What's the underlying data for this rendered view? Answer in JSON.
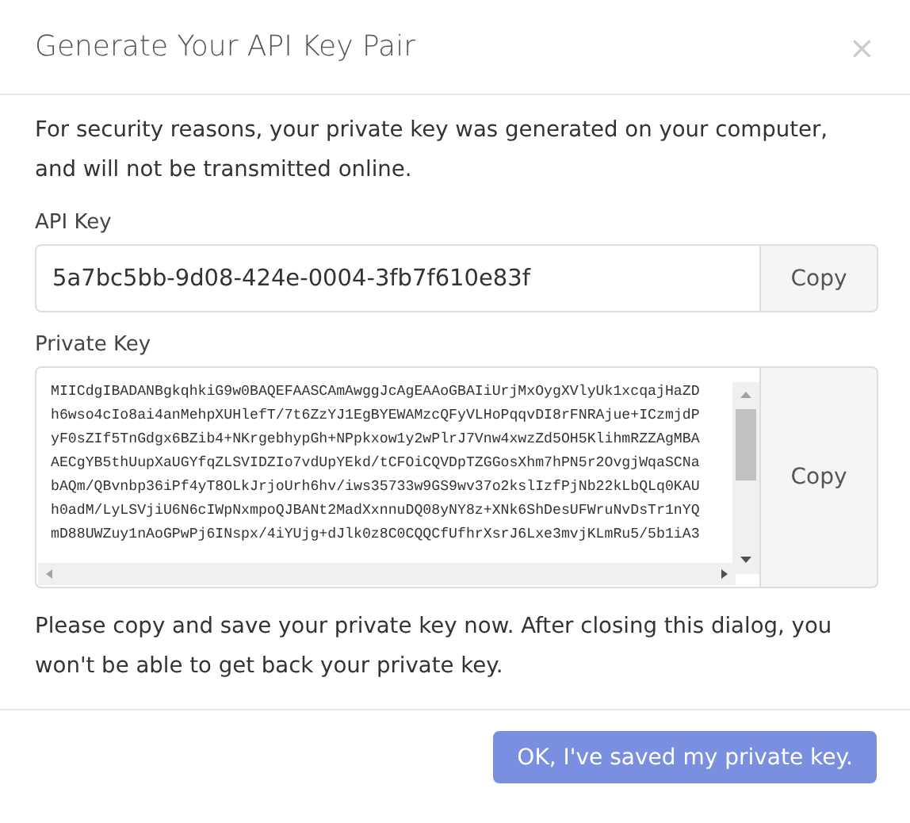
{
  "dialog": {
    "title": "Generate Your API Key Pair",
    "close": "×"
  },
  "intro": "For security reasons, your private key was generated on your computer, and will not be transmitted online.",
  "api_key": {
    "label": "API Key",
    "value": "5a7bc5bb-9d08-424e-0004-3fb7f610e83f",
    "copy": "Copy"
  },
  "private_key": {
    "label": "Private Key",
    "copy": "Copy",
    "lines": [
      "MIICdgIBADANBgkqhkiG9w0BAQEFAASCAmAwggJcAgEAAoGBAIiUrjMxOygXVlyUk1xcqajHaZD",
      "h6wso4cIo8ai4anMehpXUHlefT/7t6ZzYJ1EgBYEWAMzcQFyVLHoPqqvDI8rFNRAjue+ICzmjdP",
      "yF0sZIf5TnGdgx6BZib4+NKrgebhypGh+NPpkxow1y2wPlrJ7Vnw4xwzZd5OH5KlihmRZZAgMBA",
      "AECgYB5thUupXaUGYfqZLSVIDZIo7vdUpYEkd/tCFOiCQVDpTZGGosXhm7hPN5r2OvgjWqaSCNa",
      "bAQm/QBvnbp36iPf4yT8OLkJrjoUrh6hv/iws35733w9GS9wv37o2kslIzfPjNb22kLbQLq0KAU",
      "h0adM/LyLSVjiU6N6cIWpNxmpoQJBANt2MadXxnnuDQ08yNY8z+XNk6ShDesUFWruNvDsTr1nYQ",
      "mD88UWZuy1nAoGPwPj6INspx/4iYUjg+dJlk0z8C0CQQCfUfhrXsrJ6Lxe3mvjKLmRu5/5b1iA3"
    ]
  },
  "warning": "Please copy and save your private key now. After closing this dialog, you won't be able to get back your private key.",
  "confirm": "OK, I've saved my private key."
}
